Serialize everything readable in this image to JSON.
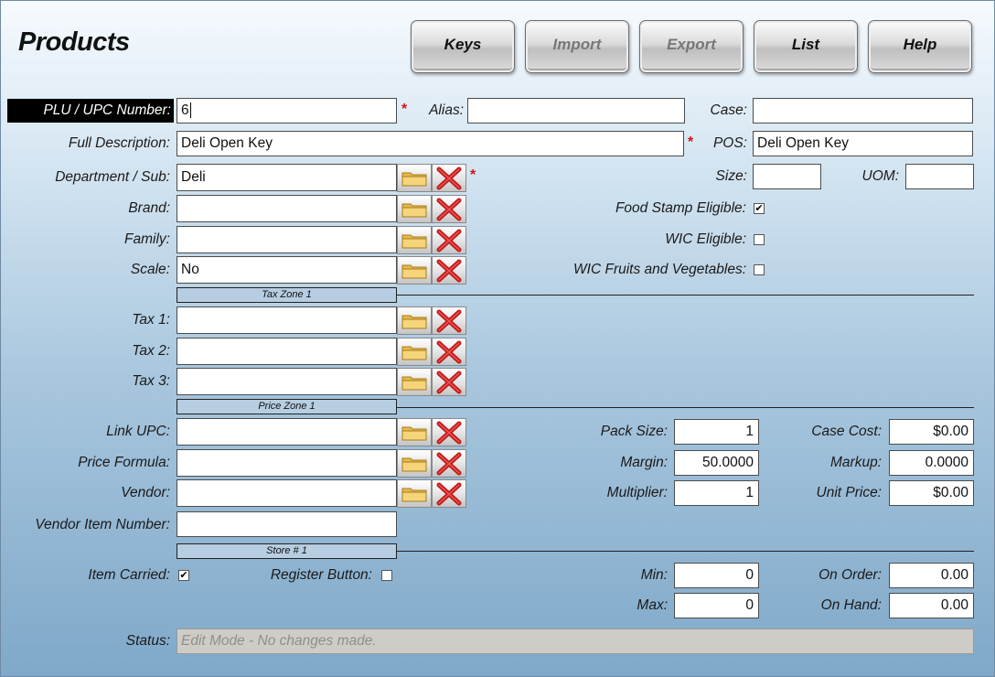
{
  "window": {
    "title": "Products"
  },
  "toolbar": {
    "keys": "Keys",
    "import": "Import",
    "export": "Export",
    "list": "List",
    "help": "Help"
  },
  "fields": {
    "plu_label": "PLU / UPC Number:",
    "plu_value": "6",
    "alias_label": "Alias:",
    "alias_value": "",
    "case_label": "Case:",
    "case_value": "",
    "full_desc_label": "Full Description:",
    "full_desc_value": "Deli Open Key",
    "pos_label": "POS:",
    "pos_value": "Deli Open Key",
    "dept_label": "Department / Sub:",
    "dept_value": "Deli",
    "size_label": "Size:",
    "size_value": "",
    "uom_label": "UOM:",
    "uom_value": "",
    "brand_label": "Brand:",
    "brand_value": "",
    "family_label": "Family:",
    "family_value": "",
    "scale_label": "Scale:",
    "scale_value": "No",
    "food_stamp_label": "Food Stamp Eligible:",
    "food_stamp_checked": true,
    "wic_label": "WIC Eligible:",
    "wic_checked": false,
    "wic_fv_label": "WIC Fruits and Vegetables:",
    "wic_fv_checked": false,
    "required_mark": "*"
  },
  "tax": {
    "section": "Tax Zone 1",
    "tax1_label": "Tax 1:",
    "tax1_value": "",
    "tax2_label": "Tax 2:",
    "tax2_value": "",
    "tax3_label": "Tax 3:",
    "tax3_value": ""
  },
  "price": {
    "section": "Price Zone 1",
    "link_upc_label": "Link UPC:",
    "link_upc_value": "",
    "price_formula_label": "Price Formula:",
    "price_formula_value": "",
    "vendor_label": "Vendor:",
    "vendor_value": "",
    "vendor_item_label": "Vendor Item Number:",
    "vendor_item_value": "",
    "pack_size_label": "Pack Size:",
    "pack_size_value": "1",
    "margin_label": "Margin:",
    "margin_value": "50.0000",
    "multiplier_label": "Multiplier:",
    "multiplier_value": "1",
    "case_cost_label": "Case Cost:",
    "case_cost_value": "$0.00",
    "markup_label": "Markup:",
    "markup_value": "0.0000",
    "unit_price_label": "Unit Price:",
    "unit_price_value": "$0.00"
  },
  "store": {
    "section": "Store # 1",
    "item_carried_label": "Item Carried:",
    "item_carried_checked": true,
    "register_button_label": "Register Button:",
    "register_button_checked": false,
    "min_label": "Min:",
    "min_value": "0",
    "max_label": "Max:",
    "max_value": "0",
    "on_order_label": "On Order:",
    "on_order_value": "0.00",
    "on_hand_label": "On Hand:",
    "on_hand_value": "0.00"
  },
  "status": {
    "label": "Status:",
    "value": "Edit Mode - No changes made."
  },
  "icons": {
    "browse": "folder-icon",
    "clear": "red-x-icon"
  },
  "colors": {
    "background_top": "#f7fbfe",
    "background_bottom": "#7fa8c9",
    "required": "#d21414",
    "section_fill": "#b7cde1",
    "highlight_label": "#000000"
  }
}
